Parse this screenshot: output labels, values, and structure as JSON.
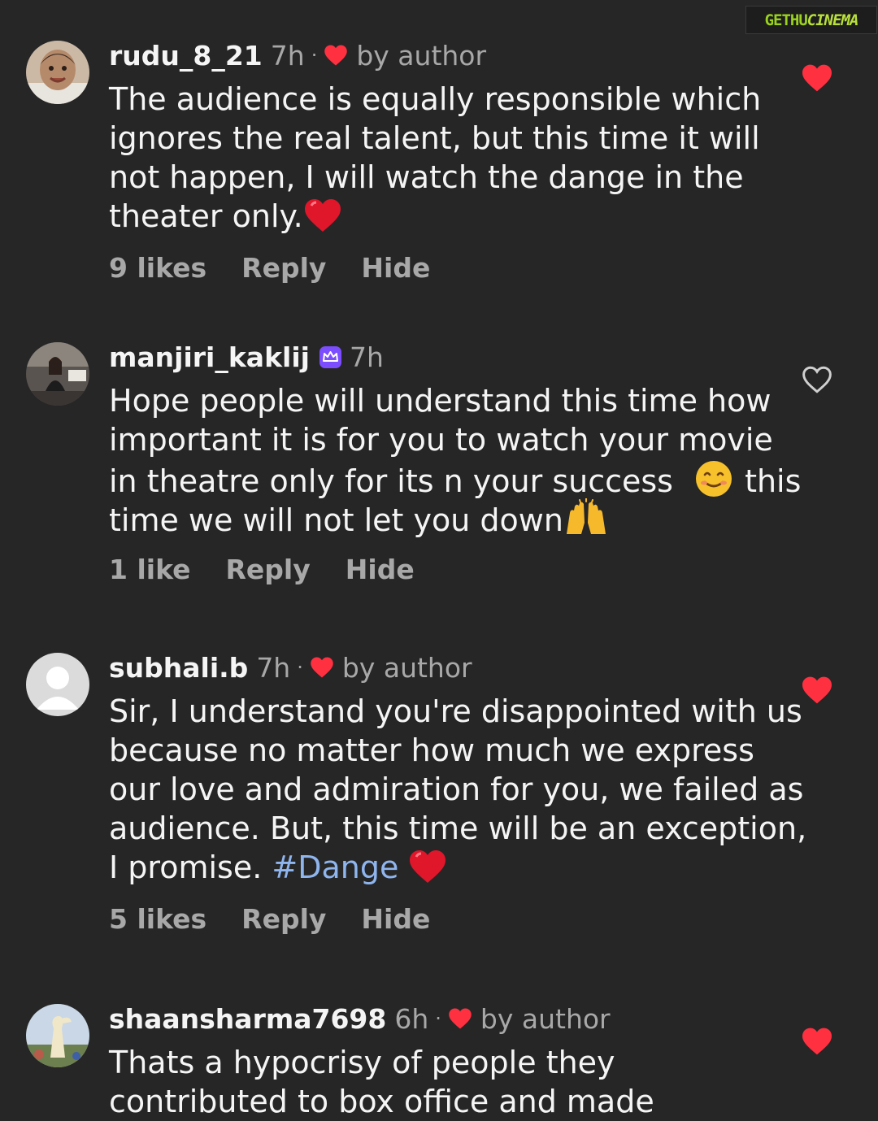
{
  "watermark": {
    "part1": "GETHU",
    "part2": "CINEMA"
  },
  "comments": [
    {
      "username": "rudu_8_21",
      "time": "7h",
      "dot": "·",
      "by_author": "by author",
      "lines": [
        "The audience is equally responsible which",
        "ignores the real talent, but this time it will",
        "not happen, I will watch the dange in the",
        "theater only."
      ],
      "likes": "9 likes",
      "reply": "Reply",
      "hide": "Hide",
      "liked": true
    },
    {
      "username": "manjiri_kaklij",
      "time": "7h",
      "lines": [
        "Hope people will understand this time how",
        "important it is for you  to watch your movie",
        "in theatre only for its n your success",
        "this",
        "time we will not let you down"
      ],
      "likes": "1 like",
      "reply": "Reply",
      "hide": "Hide",
      "liked": false
    },
    {
      "username": "subhali.b",
      "time": "7h",
      "dot": "·",
      "by_author": "by author",
      "lines": [
        "Sir, I understand you're disappointed with us",
        "because no matter how much we express",
        "our love and admiration for you, we failed as",
        "audience. But, this time will be an exception,",
        "I promise."
      ],
      "hashtag": "#Dange",
      "likes": "5 likes",
      "reply": "Reply",
      "hide": "Hide",
      "liked": true
    },
    {
      "username": "shaansharma7698",
      "time": "6h",
      "dot": "·",
      "by_author": "by author",
      "lines": [
        "Thats a hypocrisy of people they",
        "contributed to box office and made"
      ],
      "liked": true
    }
  ],
  "colors": {
    "background": "#262626",
    "heart": "#ff3040",
    "secondary_text": "#a8a8a8",
    "hashtag": "#8fb5ee",
    "badge": "#7c4dff"
  },
  "icons": [
    "heart-icon",
    "heart-outline-icon",
    "crown-badge-icon",
    "red-heart-emoji",
    "smiling-face-emoji",
    "raising-hands-emoji"
  ]
}
